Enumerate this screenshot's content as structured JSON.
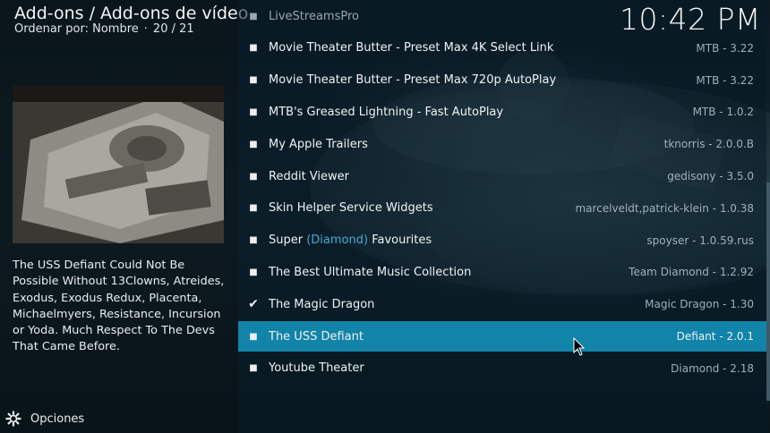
{
  "header": {
    "breadcrumb": "Add-ons / Add-ons de vídeo",
    "sort_label": "Ordenar por: Nombre",
    "separator": "·",
    "position": "20 / 21",
    "clock": "10:42 PM"
  },
  "info": {
    "description": "The USS Defiant Could Not Be Possible Without 13Clowns, Atreides, Exodus, Exodus Redux, Placenta, Michaelmyers, Resistance, Incursion or Yoda. Much Respect To The Devs That Came Before."
  },
  "options": {
    "label": "Opciones",
    "icon": "gear-icon"
  },
  "list": [
    {
      "pre": "LiveStreamsPro",
      "hl": "",
      "post": "",
      "meta": "",
      "marker": "bullet",
      "faded": true
    },
    {
      "pre": "Movie Theater Butter - Preset Max 4K Select Link",
      "hl": "",
      "post": "",
      "meta": "MTB - 3.22",
      "marker": "bullet"
    },
    {
      "pre": "Movie Theater Butter - Preset Max 720p AutoPlay",
      "hl": "",
      "post": "",
      "meta": "MTB - 3.22",
      "marker": "bullet"
    },
    {
      "pre": "MTB's Greased Lightning - Fast AutoPlay",
      "hl": "",
      "post": "",
      "meta": "MTB - 1.0.2",
      "marker": "bullet"
    },
    {
      "pre": "My Apple Trailers",
      "hl": "",
      "post": "",
      "meta": "tknorris - 2.0.0.B",
      "marker": "bullet"
    },
    {
      "pre": "Reddit Viewer",
      "hl": "",
      "post": "",
      "meta": "gedisony - 3.5.0",
      "marker": "bullet"
    },
    {
      "pre": "Skin Helper Service Widgets",
      "hl": "",
      "post": "",
      "meta": "marcelveldt,patrick-klein - 1.0.38",
      "marker": "bullet"
    },
    {
      "pre": "Super ",
      "hl": "(Diamond)",
      "post": " Favourites",
      "meta": "spoyser - 1.0.59.rus",
      "marker": "bullet"
    },
    {
      "pre": "The Best Ultimate Music Collection",
      "hl": "",
      "post": "",
      "meta": "Team Diamond - 1.2.92",
      "marker": "bullet"
    },
    {
      "pre": "The Magic Dragon",
      "hl": "",
      "post": "",
      "meta": "Magic Dragon - 1.30",
      "marker": "check"
    },
    {
      "pre": "The USS Defiant",
      "hl": "",
      "post": "",
      "meta": "Defiant - 2.0.1",
      "marker": "bullet",
      "selected": true
    },
    {
      "pre": "Youtube Theater",
      "hl": "",
      "post": "",
      "meta": "Diamond - 2.18",
      "marker": "bullet"
    }
  ],
  "colors": {
    "selection": "#1283a9",
    "highlight_text": "#4aa8d8"
  }
}
